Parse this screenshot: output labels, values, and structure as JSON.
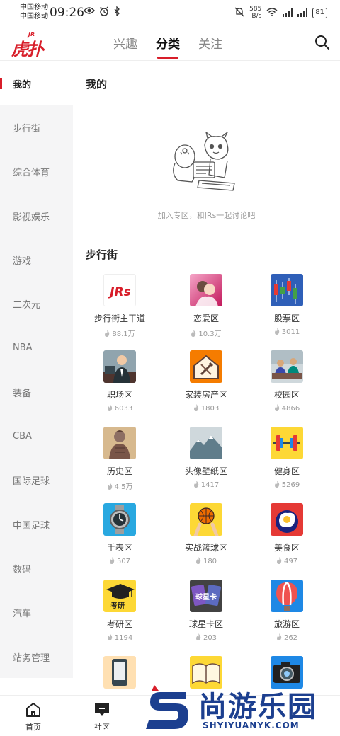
{
  "status": {
    "carrier1": "中国移动",
    "carrier2": "中国移动",
    "time": "09:26",
    "netspeed_value": "585",
    "netspeed_unit": "B/s",
    "battery": "81"
  },
  "header": {
    "logo_badge": "JR",
    "logo_text": "虎扑",
    "tabs": [
      "兴趣",
      "分类",
      "关注"
    ],
    "active_tab": "分类"
  },
  "sidebar": {
    "items": [
      "我的",
      "步行街",
      "综合体育",
      "影视娱乐",
      "游戏",
      "二次元",
      "NBA",
      "装备",
      "CBA",
      "国际足球",
      "中国足球",
      "数码",
      "汽车",
      "站务管理"
    ]
  },
  "mine": {
    "title": "我的",
    "empty_text": "加入专区，和JRs一起讨论吧"
  },
  "buxingjie": {
    "title": "步行街",
    "items": [
      {
        "name": "步行街主干道",
        "count": "88.1万",
        "icon": "jrs-logo"
      },
      {
        "name": "恋爱区",
        "count": "10.3万",
        "icon": "couple-photo"
      },
      {
        "name": "股票区",
        "count": "3011",
        "icon": "candlestick-chart"
      },
      {
        "name": "职场区",
        "count": "6033",
        "icon": "office-man"
      },
      {
        "name": "家装房产区",
        "count": "1803",
        "icon": "house-tools"
      },
      {
        "name": "校园区",
        "count": "4866",
        "icon": "classroom"
      },
      {
        "name": "历史区",
        "count": "4.5万",
        "icon": "terracotta-warrior"
      },
      {
        "name": "头像壁纸区",
        "count": "1417",
        "icon": "mountain-landscape"
      },
      {
        "name": "健身区",
        "count": "5269",
        "icon": "barbell"
      },
      {
        "name": "手表区",
        "count": "507",
        "icon": "wristwatch"
      },
      {
        "name": "实战篮球区",
        "count": "180",
        "icon": "basketball"
      },
      {
        "name": "美食区",
        "count": "497",
        "icon": "fried-egg"
      },
      {
        "name": "考研区",
        "count": "1194",
        "icon": "graduation-cap"
      },
      {
        "name": "球星卡区",
        "count": "203",
        "icon": "trading-cards"
      },
      {
        "name": "旅游区",
        "count": "262",
        "icon": "hot-air-balloon"
      },
      {
        "name": "",
        "count": "",
        "icon": "ebook-reader"
      },
      {
        "name": "",
        "count": "",
        "icon": "open-book"
      },
      {
        "name": "",
        "count": "",
        "icon": "camera"
      }
    ],
    "thumb_texts": {
      "jrs": "JRs",
      "exam": "考研",
      "card": "球星卡"
    }
  },
  "bottom_nav": {
    "home": "首页",
    "community": "社区"
  },
  "watermark": {
    "title": "尚游乐园",
    "url": "SHYIYUANYK.COM"
  },
  "colors": {
    "accent": "#d81e2a",
    "sidebar_bg": "#f5f5f6",
    "watermark": "#1c3f8f"
  }
}
